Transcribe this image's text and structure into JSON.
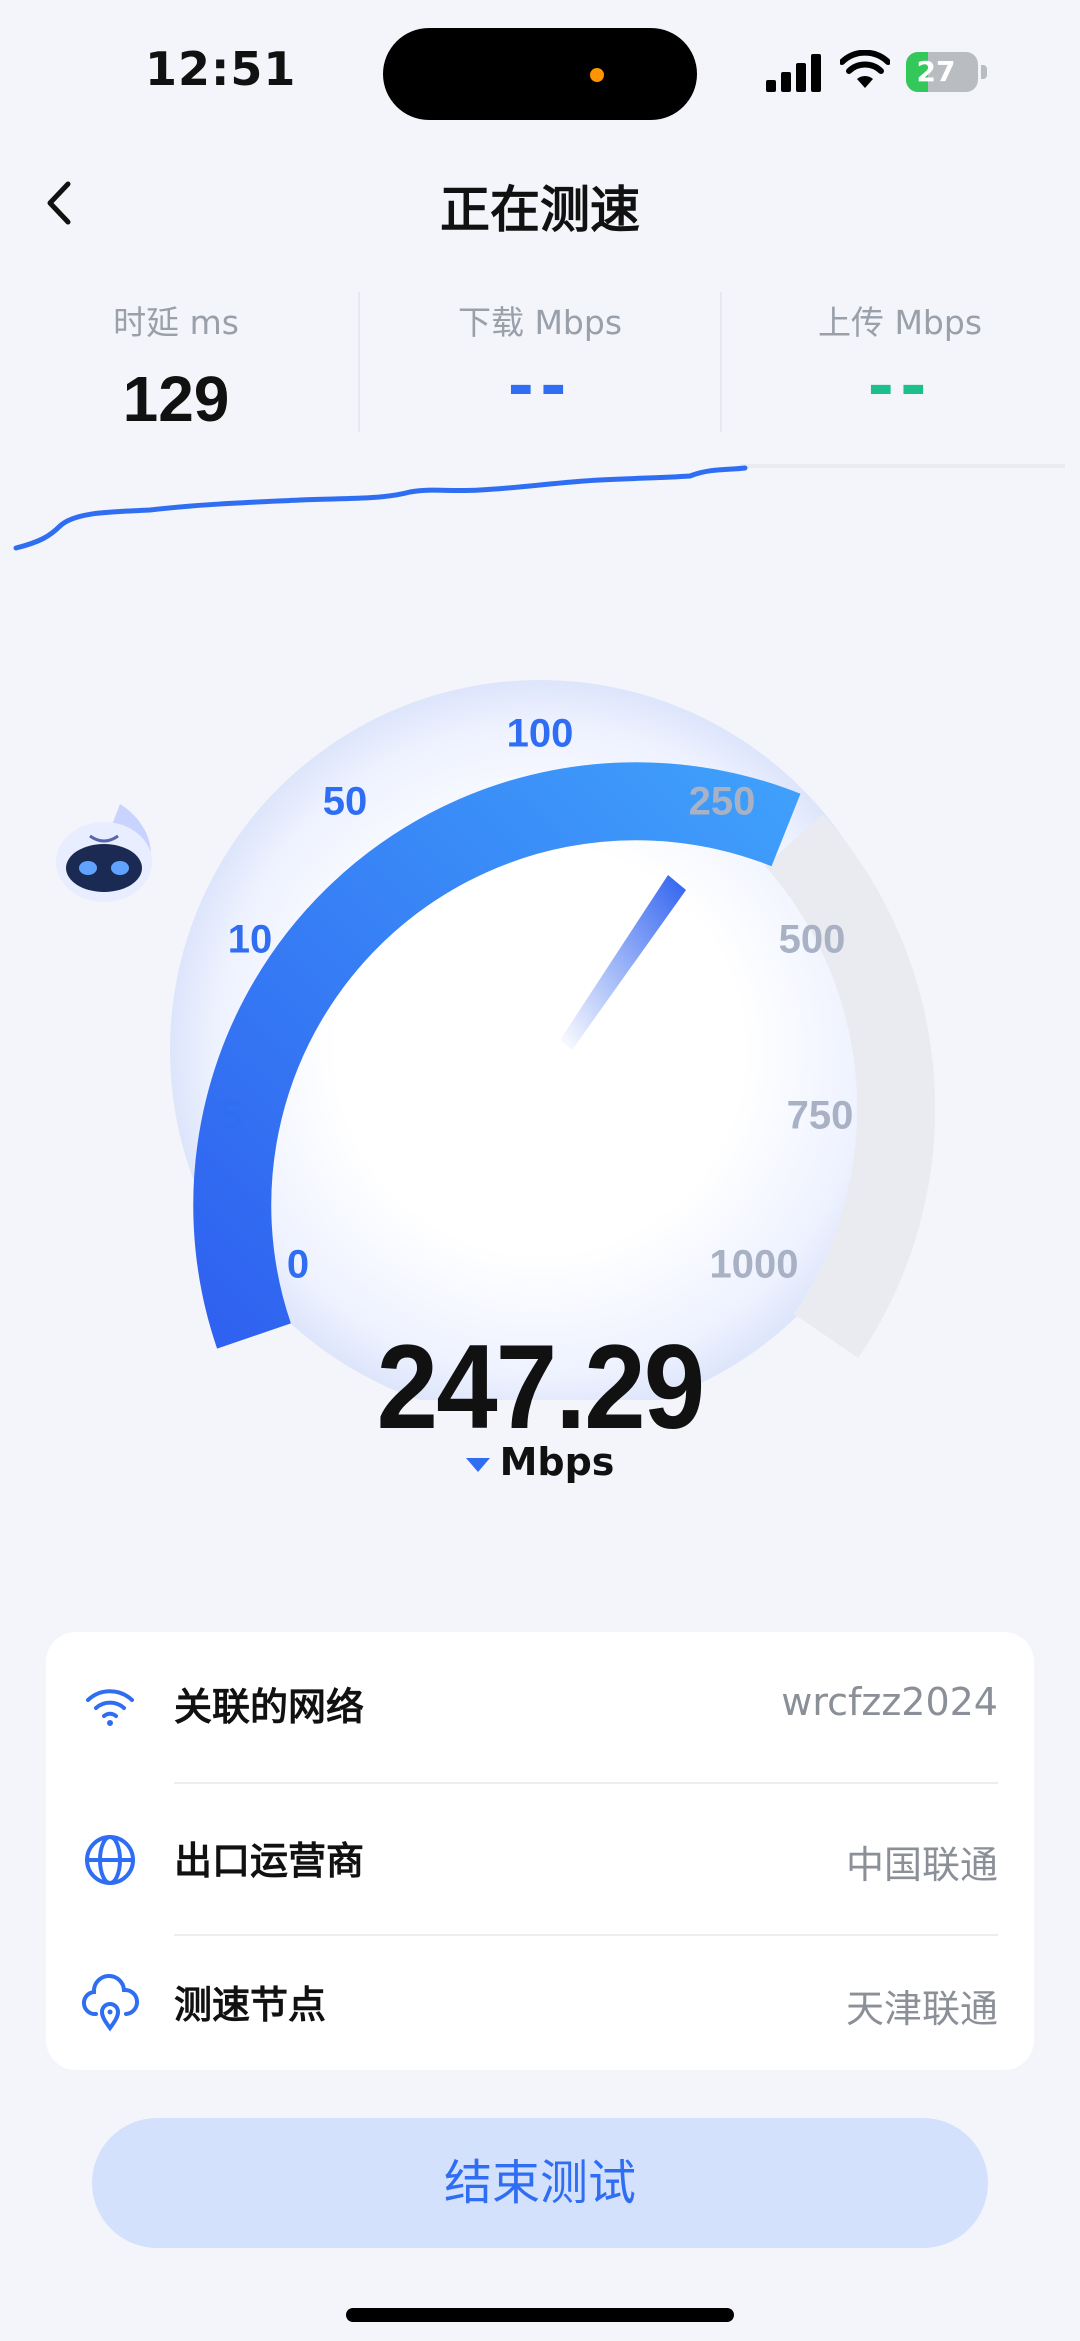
{
  "status_bar": {
    "time": "12:51",
    "battery": "27"
  },
  "nav": {
    "title": "正在测速"
  },
  "metrics": [
    {
      "label": "时延 ms",
      "value": "129",
      "color": "#111111"
    },
    {
      "label": "下载 Mbps",
      "value": "--",
      "color": "#2f6ef3"
    },
    {
      "label": "上传 Mbps",
      "value": "--",
      "color": "#1bbf8a"
    }
  ],
  "gauge": {
    "scale": [
      "0",
      "5",
      "10",
      "50",
      "100",
      "250",
      "500",
      "750",
      "1000"
    ],
    "current_value": "247.29",
    "unit": "Mbps",
    "active_color": "#2f6ef3",
    "inactive_color": "#a8b2c4"
  },
  "info_card": {
    "rows": [
      {
        "icon": "wifi-icon",
        "label": "关联的网络",
        "value": "wrcfzz2024"
      },
      {
        "icon": "globe-icon",
        "label": "出口运营商",
        "value": "中国联通"
      },
      {
        "icon": "cloud-location-icon",
        "label": "测速节点",
        "value": "天津联通"
      }
    ]
  },
  "actions": {
    "end_test": "结束测试"
  }
}
